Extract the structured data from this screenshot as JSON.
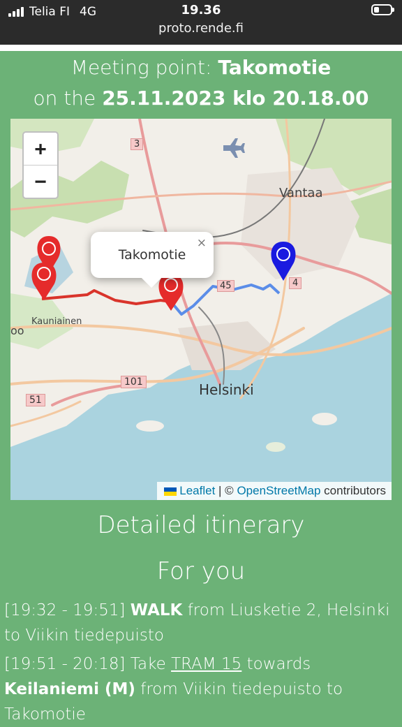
{
  "status": {
    "carrier": "Telia FI",
    "network": "4G",
    "time": "19.36",
    "url": "proto.rende.fi",
    "battery_level": 0.3
  },
  "meeting": {
    "prefix": "Meeting point: ",
    "place": "Takomotie",
    "date_prefix": "on the ",
    "datetime": "25.11.2023 klo 20.18.00"
  },
  "map": {
    "zoom_in": "+",
    "zoom_out": "−",
    "popup_text": "Takomotie",
    "popup_close": "×",
    "labels": {
      "vantaa": "Vantaa",
      "helsinki": "Helsinki",
      "kauniainen": "Kauniainen",
      "oo": "oo",
      "road_3": "3",
      "road_45": "45",
      "road_4": "4",
      "road_101": "101",
      "road_51": "51"
    },
    "attribution": {
      "leaflet": "Leaflet",
      "sep": " | © ",
      "osm": "OpenStreetMap",
      "contributors": " contributors"
    },
    "colors": {
      "walk_route": "#5b8de8",
      "tram_route": "#d9342b",
      "destination_marker": "#e52b2b",
      "start_marker": "#1a1ae0"
    }
  },
  "itinerary": {
    "title": "Detailed itinerary",
    "subtitle": "For you",
    "steps": [
      {
        "time": "[19:32 - 19:51]",
        "mode": "WALK",
        "text": "from Liusketie 2, Helsinki to Viikin tiedepuisto"
      },
      {
        "time": "[19:51 - 20:18]",
        "take": "Take",
        "line": "TRAM 15",
        "towards": "towards",
        "destination": "Keilaniemi (M)",
        "text": "from Viikin tiedepuisto to Takomotie"
      }
    ]
  }
}
